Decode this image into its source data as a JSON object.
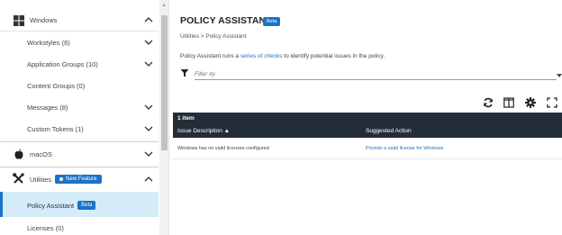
{
  "sidebar": {
    "windows": {
      "label": "Windows",
      "icon": "windows-logo-icon"
    },
    "windows_items": [
      {
        "label": "Workstyles (6)",
        "expandable": true
      },
      {
        "label": "Application Groups (10)",
        "expandable": true
      },
      {
        "label": "Content Groups (0)",
        "expandable": false
      },
      {
        "label": "Messages (8)",
        "expandable": true
      },
      {
        "label": "Custom Tokens (1)",
        "expandable": true
      }
    ],
    "macos": {
      "label": "macOS",
      "icon": "apple-logo-icon"
    },
    "utilities": {
      "label": "Utilities",
      "badge": "New Feature",
      "icon": "tools-icon"
    },
    "utilities_items": [
      {
        "label": "Policy Assistant",
        "badge": "Beta",
        "active": true
      },
      {
        "label": "Licenses (0)"
      }
    ]
  },
  "main": {
    "title": "POLICY ASSISTANT",
    "title_badge": "Beta",
    "breadcrumb": "Utilities > Policy Assistant",
    "description": {
      "before": "Policy Assistant runs a ",
      "link": "series of checks",
      "after": " to identify potential issues in the policy."
    },
    "filter": {
      "placeholder": "Filter by"
    },
    "toolbar": [
      "refresh-icon",
      "columns-icon",
      "settings-icon",
      "fullscreen-icon"
    ],
    "grid": {
      "item_count": "1 item",
      "columns": [
        "Issue Description ▲",
        "Suggested Action"
      ],
      "rows": [
        {
          "issue": "Windows has no valid licenses configured",
          "action": "Provide a valid license for Windows"
        }
      ]
    }
  },
  "colors": {
    "accent": "#1a73c9",
    "grid_header": "#232d38",
    "active_row": "#d3ecf7"
  }
}
